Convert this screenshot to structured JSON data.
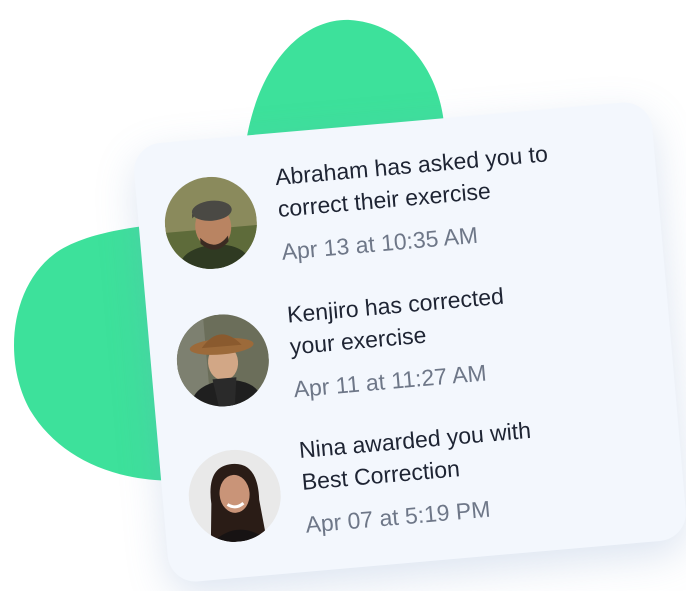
{
  "notifications": [
    {
      "message": "Abraham has asked you to\ncorrect their exercise",
      "timestamp": "Apr 13 at 10:35 AM",
      "avatar": "avatar-abraham"
    },
    {
      "message": "Kenjiro has corrected\nyour exercise",
      "timestamp": "Apr 11 at 11:27 AM",
      "avatar": "avatar-kenjiro"
    },
    {
      "message": "Nina awarded you with\nBest Correction",
      "timestamp": "Apr 07 at 5:19 PM",
      "avatar": "avatar-nina"
    }
  ],
  "colors": {
    "blob": "#3de19b",
    "card": "#f3f7fd",
    "text": "#1e2433",
    "muted": "#6e7788"
  }
}
